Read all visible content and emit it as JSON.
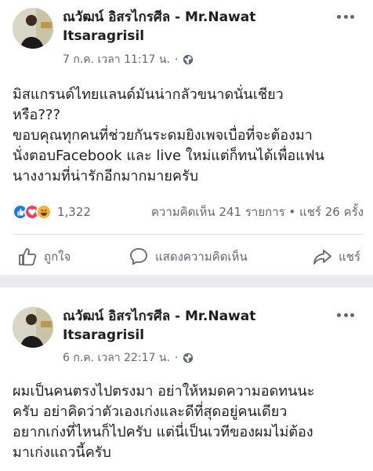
{
  "posts": [
    {
      "author": "ณวัฒน์ อิสรไกรศีล - Mr.Nawat Itsaragrisil",
      "timestamp": "7 ก.ค. เวลา 11:17 น.",
      "privacy_icon": "globe-icon",
      "body": "มิสแกรนด์ไทยแลนด์มันน่ากลัวขนาดนั่นเชียว\nหรือ???\nขอบคุณทุกคนที่ช่วยกันระดมยิงเพจเบื่อที่จะต้องมา\nนั่งตอบFacebook และ live ใหม่แต่ก็ทนได้เพื่อแฟน\nนางงามที่น่ารักอีกมากมายครับ",
      "reaction_count": "1,322",
      "engagement": "ความคิดเห็น 241 รายการ • แชร์ 26 ครั้ง",
      "actions": {
        "like": "ถูกใจ",
        "comment": "แสดงความคิดเห็น",
        "share": "แชร์"
      }
    },
    {
      "author": "ณวัฒน์ อิสรไกรศีล - Mr.Nawat Itsaragrisil",
      "timestamp": "6 ก.ค. เวลา 22:17 น.",
      "privacy_icon": "globe-icon",
      "body": "ผมเป็นคนตรงไปตรงมา อย่าให้หมดความอดทนนะ\nครับ อย่าคิดว่าตัวเองเก่งและดีที่สุดอยู่คนเดียว\nอยากเก่งที่ไหนก็ไปครับ แต่นี่เป็นเวทีของผมไม่ต้อง\nมาเก่งแถวนี้ครับ"
    }
  ],
  "colors": {
    "like_blue": "#1877f2",
    "love_red": "#f33e58",
    "haha_yellow": "#f7b125",
    "secondary_text": "#606770",
    "separator": "#e9ebee"
  }
}
